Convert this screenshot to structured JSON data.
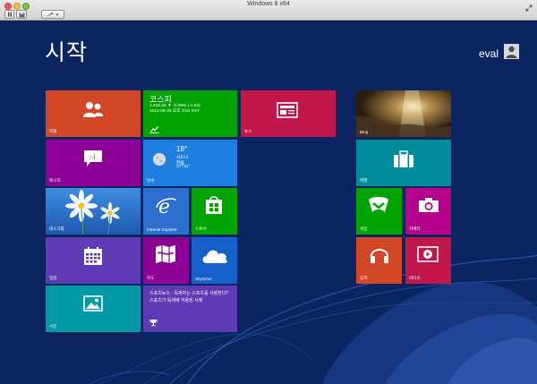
{
  "window": {
    "title": "Windows 8 x64"
  },
  "start": {
    "title": "시작",
    "user": "eval"
  },
  "colors": {
    "background": "#0b2560",
    "people": "#d24726",
    "finance": "#00a300",
    "news": "#c1174a",
    "bing": "#3a2a15",
    "messaging": "#8c0095",
    "weather": "#1f7fe0",
    "travel": "#008b9a",
    "desktop": "#2e74c8",
    "ie": "#2d6fd1",
    "store": "#00a300",
    "games": "#00a300",
    "camera": "#b4008a",
    "calendar": "#5e3ab4",
    "maps": "#8c0095",
    "skydrive": "#1561c9",
    "music": "#d24726",
    "video": "#c1174a",
    "photos": "#009aa5",
    "sports": "#5e3ab4"
  },
  "tiles": {
    "people": {
      "label": "피플",
      "icon": "people-icon"
    },
    "finance": {
      "title": "코스피",
      "line1": "1,916.33  ▼ -0.08% (-1.54)",
      "line2": "2012-08-28 오후 3:02 KST",
      "icon": "chart-icon"
    },
    "news": {
      "label": "뉴스",
      "icon": "newspaper-icon"
    },
    "bing": {
      "label": "Bing"
    },
    "messaging": {
      "label": "메시지",
      "icon": "chat-icon"
    },
    "weather": {
      "label": "날씨",
      "temp": "18°",
      "city": "시드니",
      "condition": "맑음",
      "range": "27°/11°",
      "icon": "moon-icon"
    },
    "travel": {
      "label": "여행",
      "icon": "suitcase-icon"
    },
    "desktop": {
      "label": "데스크톱"
    },
    "ie": {
      "label": "Internet Explorer",
      "icon": "ie-icon"
    },
    "store": {
      "label": "스토어",
      "icon": "store-icon"
    },
    "games": {
      "label": "게임",
      "icon": "controller-icon"
    },
    "camera": {
      "label": "카메라",
      "icon": "camera-icon"
    },
    "calendar": {
      "label": "일정",
      "icon": "calendar-icon"
    },
    "maps": {
      "label": "지도",
      "icon": "map-icon"
    },
    "skydrive": {
      "label": "SkyDrive",
      "icon": "cloud-icon"
    },
    "music": {
      "label": "음악",
      "icon": "headphones-icon"
    },
    "video": {
      "label": "비디오",
      "icon": "play-icon"
    },
    "photos": {
      "label": "사진",
      "icon": "photo-icon"
    },
    "sports": {
      "headline": "스포츠뉴스 - 독재자는 스포츠를 사랑한다? 스포츠가 독재에 악용된 사례",
      "icon": "trophy-icon"
    }
  }
}
